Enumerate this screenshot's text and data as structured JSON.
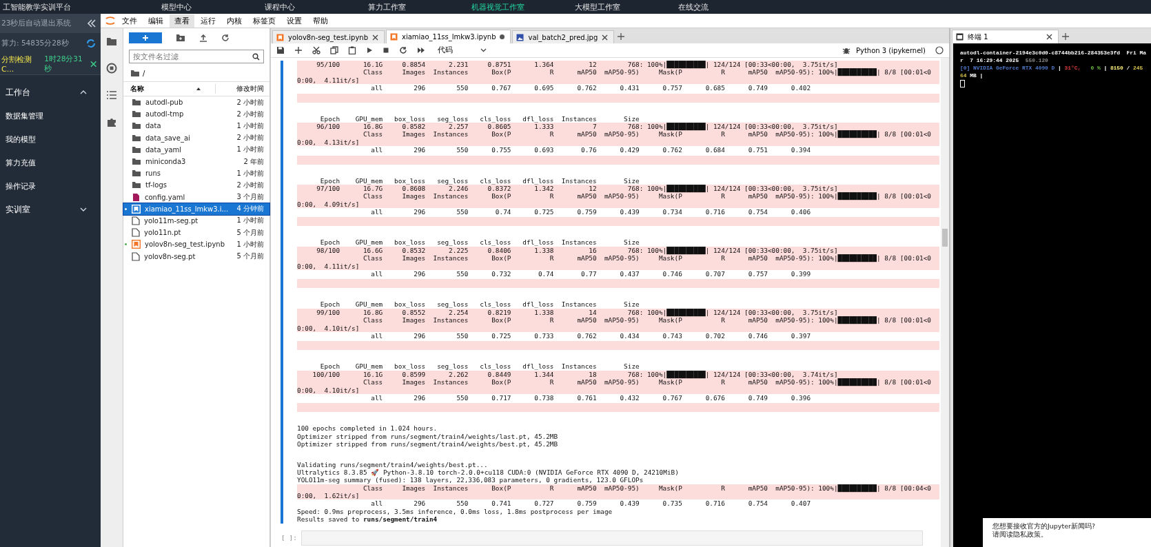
{
  "top_nav": {
    "brand": "工智能教学实训平台",
    "items": [
      {
        "label": "模型中心",
        "selected": false
      },
      {
        "label": "课程中心",
        "selected": false
      },
      {
        "label": "算力工作室",
        "selected": false
      },
      {
        "label": "机器视觉工作室",
        "selected": true
      },
      {
        "label": "大模型工作室",
        "selected": false
      },
      {
        "label": "在线交流",
        "selected": false
      }
    ]
  },
  "sidebar": {
    "logout_notice": "23秒后自动退出系统",
    "compute": "算力: 54835分28秒",
    "instance": {
      "name": "分割检测C...",
      "time": "1时28分31秒"
    },
    "sections": [
      {
        "label": "工作台",
        "expanded": true,
        "children": [
          {
            "label": "数据集管理"
          },
          {
            "label": "我的模型"
          },
          {
            "label": "算力充值"
          },
          {
            "label": "操作记录"
          }
        ]
      },
      {
        "label": "实训室",
        "expanded": false
      }
    ]
  },
  "menu_bar": [
    {
      "label": "文件",
      "selected": false
    },
    {
      "label": "编辑",
      "selected": false
    },
    {
      "label": "查看",
      "selected": true
    },
    {
      "label": "运行",
      "selected": false
    },
    {
      "label": "内核",
      "selected": false
    },
    {
      "label": "标签页",
      "selected": false
    },
    {
      "label": "设置",
      "selected": false
    },
    {
      "label": "帮助",
      "selected": false
    }
  ],
  "file_browser": {
    "filter_placeholder": "按文件名过滤",
    "path": "/",
    "columns": [
      "名称",
      "修改时间"
    ],
    "files": [
      {
        "name": "autodl-pub",
        "modified": "2 小时前",
        "kind": "folder",
        "selected": false,
        "running": false
      },
      {
        "name": "autodl-tmp",
        "modified": "2 小时前",
        "kind": "folder",
        "selected": false,
        "running": false
      },
      {
        "name": "data",
        "modified": "1 小时前",
        "kind": "folder",
        "selected": false,
        "running": false
      },
      {
        "name": "data_save_ai",
        "modified": "2 小时前",
        "kind": "folder",
        "selected": false,
        "running": false
      },
      {
        "name": "data_yaml",
        "modified": "1 小时前",
        "kind": "folder",
        "selected": false,
        "running": false
      },
      {
        "name": "miniconda3",
        "modified": "2 年前",
        "kind": "folder",
        "selected": false,
        "running": false
      },
      {
        "name": "runs",
        "modified": "1 小时前",
        "kind": "folder",
        "selected": false,
        "running": false
      },
      {
        "name": "tf-logs",
        "modified": "2 小时前",
        "kind": "folder",
        "selected": false,
        "running": false
      },
      {
        "name": "config.yaml",
        "modified": "3 个月前",
        "kind": "yaml",
        "selected": false,
        "running": false
      },
      {
        "name": "xiamiao_11ss_lmkw3.i...",
        "modified": "4 分钟前",
        "kind": "notebook",
        "selected": true,
        "running": true
      },
      {
        "name": "yolo11m-seg.pt",
        "modified": "1 小时前",
        "kind": "file",
        "selected": false,
        "running": false
      },
      {
        "name": "yolo11n.pt",
        "modified": "5 个月前",
        "kind": "file",
        "selected": false,
        "running": false
      },
      {
        "name": "yolov8n-seg_test.ipynb",
        "modified": "1 小时前",
        "kind": "notebook",
        "selected": false,
        "running": true
      },
      {
        "name": "yolov8n-seg.pt",
        "modified": "5 个月前",
        "kind": "file",
        "selected": false,
        "running": false
      }
    ]
  },
  "tabs": [
    {
      "label": "yolov8n-seg_test.ipynb",
      "kind": "notebook",
      "selected": false,
      "dirty": false
    },
    {
      "label": "xiamiao_11ss_lmkw3.ipynb",
      "kind": "notebook",
      "selected": true,
      "dirty": true
    },
    {
      "label": "val_batch2_pred.jpg",
      "kind": "image",
      "selected": false,
      "dirty": false
    }
  ],
  "toolbar": {
    "cell_type": "代码",
    "kernel": "Python 3 (ipykernel)"
  },
  "output": [
    {
      "kind": "stderr",
      "lines": [
        "     95/100      16.1G     0.8854      2.231     0.8751      1.364         12        768: 100%|██████████| 124/124 [00:33<00:00,  3.75it/s]",
        "                 Class     Images  Instances      Box(P          R      mAP50  mAP50-95)     Mask(P          R      mAP50  mAP50-95): 100%|██████████| 8/8 [00:01<0",
        "0:00,  4.11it/s]"
      ]
    },
    {
      "kind": "stdout",
      "lines": [
        "                   all        296        550      0.767      0.695      0.762      0.431      0.757      0.685      0.749      0.402"
      ]
    },
    {
      "kind": "stderr_blank"
    },
    {
      "kind": "stdout_blank"
    },
    {
      "kind": "stdout",
      "lines": [
        "      Epoch    GPU_mem   box_loss   seg_loss   cls_loss   dfl_loss  Instances       Size"
      ]
    },
    {
      "kind": "stderr",
      "lines": [
        "     96/100      16.8G     0.8582      2.257     0.8605      1.333          7        768: 100%|██████████| 124/124 [00:33<00:00,  3.75it/s]",
        "                 Class     Images  Instances      Box(P          R      mAP50  mAP50-95)     Mask(P          R      mAP50  mAP50-95): 100%|██████████| 8/8 [00:01<0",
        "0:00,  4.13it/s]"
      ]
    },
    {
      "kind": "stdout",
      "lines": [
        "                   all        296        550      0.755      0.693       0.76      0.429      0.762      0.684      0.751      0.394"
      ]
    },
    {
      "kind": "stderr_blank"
    },
    {
      "kind": "stdout_blank"
    },
    {
      "kind": "stdout",
      "lines": [
        "      Epoch    GPU_mem   box_loss   seg_loss   cls_loss   dfl_loss  Instances       Size"
      ]
    },
    {
      "kind": "stderr",
      "lines": [
        "     97/100      16.7G     0.8608      2.246     0.8372      1.342         12        768: 100%|██████████| 124/124 [00:33<00:00,  3.75it/s]",
        "                 Class     Images  Instances      Box(P          R      mAP50  mAP50-95)     Mask(P          R      mAP50  mAP50-95): 100%|██████████| 8/8 [00:01<0",
        "0:00,  4.09it/s]"
      ]
    },
    {
      "kind": "stdout",
      "lines": [
        "                   all        296        550       0.74      0.725      0.759      0.439      0.734      0.716      0.754      0.406"
      ]
    },
    {
      "kind": "stderr_blank"
    },
    {
      "kind": "stdout_blank"
    },
    {
      "kind": "stdout",
      "lines": [
        "      Epoch    GPU_mem   box_loss   seg_loss   cls_loss   dfl_loss  Instances       Size"
      ]
    },
    {
      "kind": "stderr",
      "lines": [
        "     98/100      16.6G     0.8532      2.225     0.8406      1.338         16        768: 100%|██████████| 124/124 [00:33<00:00,  3.75it/s]",
        "                 Class     Images  Instances      Box(P          R      mAP50  mAP50-95)     Mask(P          R      mAP50  mAP50-95): 100%|██████████| 8/8 [00:01<0",
        "0:00,  4.11it/s]"
      ]
    },
    {
      "kind": "stdout",
      "lines": [
        "                   all        296        550      0.732       0.74       0.77      0.437      0.746      0.707      0.757      0.399"
      ]
    },
    {
      "kind": "stderr_blank"
    },
    {
      "kind": "stdout_blank"
    },
    {
      "kind": "stdout",
      "lines": [
        "      Epoch    GPU_mem   box_loss   seg_loss   cls_loss   dfl_loss  Instances       Size"
      ]
    },
    {
      "kind": "stderr",
      "lines": [
        "     99/100      16.8G     0.8552      2.254     0.8219      1.338         14        768: 100%|██████████| 124/124 [00:33<00:00,  3.75it/s]",
        "                 Class     Images  Instances      Box(P          R      mAP50  mAP50-95)     Mask(P          R      mAP50  mAP50-95): 100%|██████████| 8/8 [00:01<0",
        "0:00,  4.10it/s]"
      ]
    },
    {
      "kind": "stdout",
      "lines": [
        "                   all        296        550      0.725      0.733      0.762      0.434      0.743      0.702      0.746      0.397"
      ]
    },
    {
      "kind": "stderr_blank"
    },
    {
      "kind": "stdout_blank"
    },
    {
      "kind": "stdout",
      "lines": [
        "      Epoch    GPU_mem   box_loss   seg_loss   cls_loss   dfl_loss  Instances       Size"
      ]
    },
    {
      "kind": "stderr",
      "lines": [
        "    100/100      16.1G     0.8599      2.262     0.8449      1.344         18        768: 100%|██████████| 124/124 [00:33<00:00,  3.74it/s]",
        "                 Class     Images  Instances      Box(P          R      mAP50  mAP50-95)     Mask(P          R      mAP50  mAP50-95): 100%|██████████| 8/8 [00:01<0",
        "0:00,  4.10it/s]"
      ]
    },
    {
      "kind": "stdout",
      "lines": [
        "                   all        296        550      0.717      0.738      0.761      0.432      0.767      0.676      0.749      0.396"
      ]
    },
    {
      "kind": "stderr_blank"
    },
    {
      "kind": "stdout_blank"
    },
    {
      "kind": "stdout",
      "lines": [
        "100 epochs completed in 1.024 hours.",
        "Optimizer stripped from runs/segment/train4/weights/last.pt, 45.2MB",
        "Optimizer stripped from runs/segment/train4/weights/best.pt, 45.2MB"
      ]
    },
    {
      "kind": "stdout_blank"
    },
    {
      "kind": "stdout",
      "lines": [
        "Validating runs/segment/train4/weights/best.pt...",
        "Ultralytics 8.3.85 🚀 Python-3.8.10 torch-2.0.0+cu118 CUDA:0 (NVIDIA GeForce RTX 4090 D, 24210MiB)",
        "YOLO11m-seg summary (fused): 138 layers, 22,336,083 parameters, 0 gradients, 123.0 GFLOPs"
      ]
    },
    {
      "kind": "stderr",
      "lines": [
        "                 Class     Images  Instances      Box(P          R      mAP50  mAP50-95)     Mask(P          R      mAP50  mAP50-95): 100%|██████████| 8/8 [00:04<0",
        "0:00,  1.62it/s]"
      ]
    },
    {
      "kind": "stdout",
      "lines": [
        "                   all        296        550      0.741      0.727      0.759      0.439      0.735      0.716      0.754      0.407",
        "Speed: 0.9ms preprocess, 3.5ms inference, 0.0ms loss, 1.8ms postprocess per image",
        "Results saved to **runs/segment/train4**"
      ]
    }
  ],
  "empty_cell": {
    "prompt": "[ ]:"
  },
  "terminal": {
    "tab": "终端 1",
    "lines": [
      [
        {
          "text": "autodl-container-2194e3c0d0-c8744bb216-284353e3fd  Fri Ma",
          "kind": "plain"
        }
      ],
      [
        {
          "text": "r  7 16:29:44 2025  ",
          "kind": "plain"
        },
        {
          "text": "550.120",
          "kind": "dim"
        }
      ],
      [
        {
          "text": "[0] NVIDIA GeForce RTX 4090 D",
          "kind": "gpu"
        },
        {
          "text": " | ",
          "kind": "plain"
        },
        {
          "text": "31°C,",
          "kind": "temp"
        },
        {
          "text": "   0 %",
          "kind": "util"
        },
        {
          "text": " | ",
          "kind": "plain"
        },
        {
          "text": "8150",
          "kind": "mem_used"
        },
        {
          "text": " / ",
          "kind": "plain"
        },
        {
          "text": "245",
          "kind": "mem_total"
        }
      ],
      [
        {
          "text": "64",
          "kind": "mem_total"
        },
        {
          "text": " MB |",
          "kind": "plain"
        }
      ]
    ]
  },
  "notification": {
    "lines": [
      "您想要接收官方的Jupyter新闻吗?",
      "请阅读隐私政策。"
    ]
  }
}
